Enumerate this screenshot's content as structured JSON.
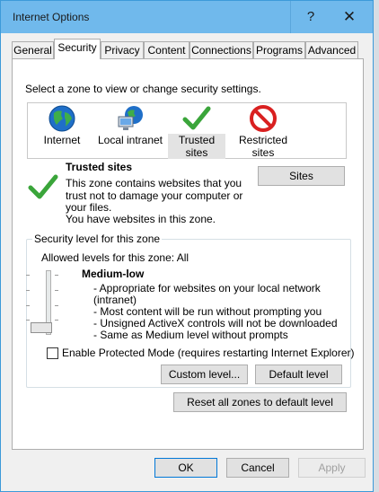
{
  "window": {
    "title": "Internet Options",
    "help_glyph": "?",
    "close_glyph": "✕"
  },
  "tabs": [
    {
      "label": "General"
    },
    {
      "label": "Security",
      "active": true
    },
    {
      "label": "Privacy"
    },
    {
      "label": "Content"
    },
    {
      "label": "Connections"
    },
    {
      "label": "Programs"
    },
    {
      "label": "Advanced"
    }
  ],
  "security": {
    "zone_prompt": "Select a zone to view or change security settings.",
    "zones": [
      {
        "label": "Internet",
        "icon": "globe-icon"
      },
      {
        "label": "Local intranet",
        "icon": "intranet-icon"
      },
      {
        "label": "Trusted sites",
        "icon": "checkmark-icon",
        "selected": true
      },
      {
        "label": "Restricted sites",
        "icon": "restricted-icon"
      }
    ],
    "zone_title": "Trusted sites",
    "zone_desc_1": "This zone contains websites that you",
    "zone_desc_2": "trust not to damage your computer or",
    "zone_desc_3": "your files.",
    "zone_desc_4": "You have websites in this zone.",
    "sites_button": "Sites",
    "level_group_title": "Security level for this zone",
    "allowed_levels": "Allowed levels for this zone: All",
    "level_name": "Medium-low",
    "level_desc": [
      "- Appropriate for websites on your local network",
      "(intranet)",
      "- Most content will be run without prompting you",
      "- Unsigned ActiveX controls will not be downloaded",
      "- Same as Medium level without prompts"
    ],
    "level_slider": {
      "position": 1,
      "levels": 5
    },
    "protected_mode_label": "Enable Protected Mode (requires restarting Internet Explorer)",
    "protected_mode_checked": false,
    "custom_level_button": "Custom level...",
    "default_level_button": "Default level",
    "reset_all_button": "Reset all zones to default level"
  },
  "footer": {
    "ok": "OK",
    "cancel": "Cancel",
    "apply": "Apply"
  }
}
